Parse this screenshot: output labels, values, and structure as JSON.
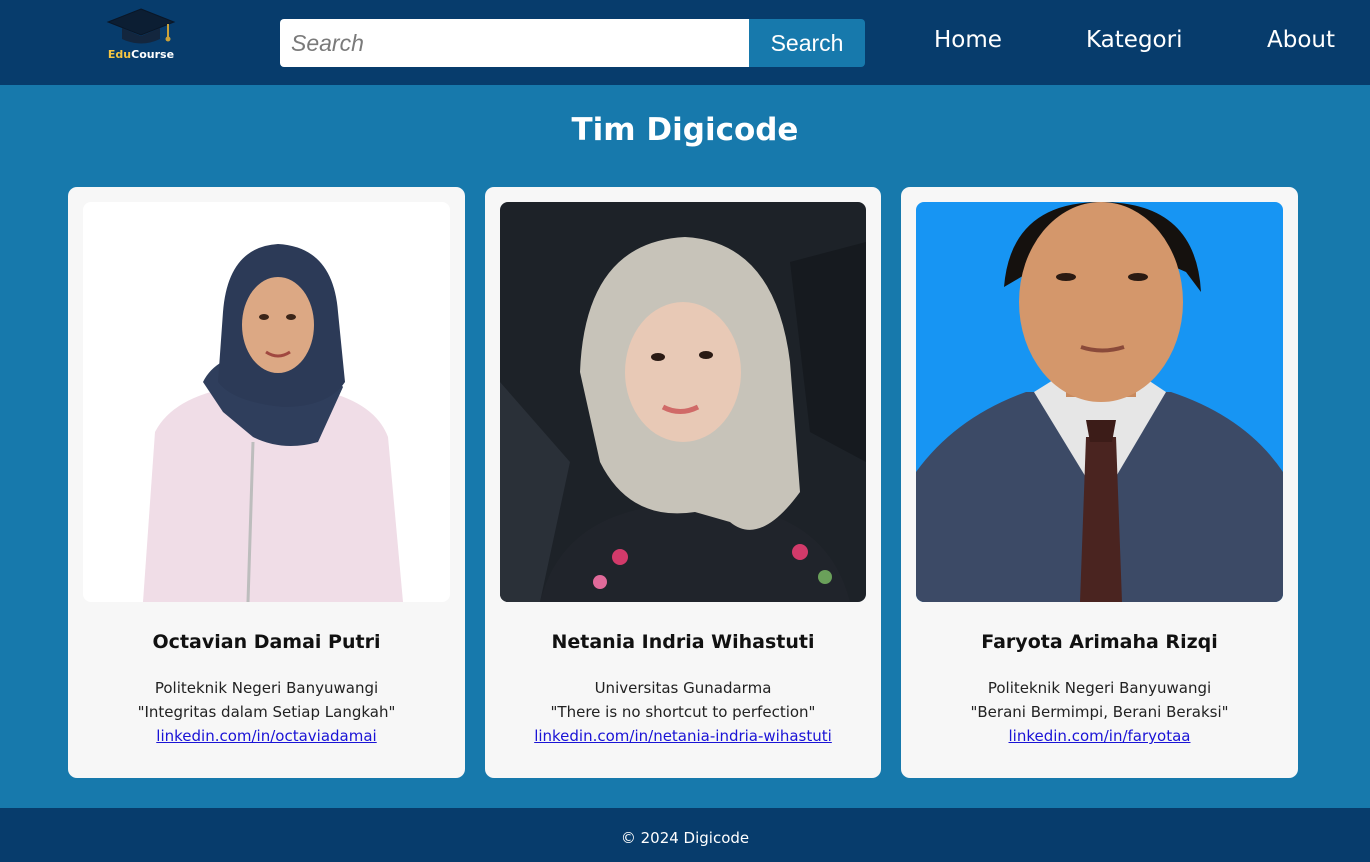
{
  "header": {
    "logo_text_part1": "Edu",
    "logo_text_part2": "Course",
    "search_placeholder": "Search",
    "search_value": "",
    "search_button_label": "Search",
    "nav": {
      "home": "Home",
      "kategori": "Kategori",
      "about": "About"
    }
  },
  "main": {
    "title": "Tim Digicode",
    "members": [
      {
        "name": "Octavian Damai Putri",
        "institution": "Politeknik Negeri Banyuwangi",
        "quote": "\"Integritas dalam Setiap Langkah\"",
        "linkedin": "linkedin.com/in/octaviadamai"
      },
      {
        "name": "Netania Indria Wihastuti",
        "institution": "Universitas Gunadarma",
        "quote": "\"There is no shortcut to perfection\"",
        "linkedin": "linkedin.com/in/netania-indria-wihastuti"
      },
      {
        "name": "Faryota Arimaha Rizqi",
        "institution": "Politeknik Negeri Banyuwangi",
        "quote": "\"Berani Bermimpi, Berani Beraksi\"",
        "linkedin": "linkedin.com/in/faryotaa"
      }
    ]
  },
  "footer": {
    "text": "© 2024 Digicode"
  },
  "colors": {
    "header_bg": "#073c6c",
    "body_bg": "#1779ac",
    "card_bg": "#f7f7f7",
    "link": "#1a13d6",
    "logo_accent": "#f5c542"
  },
  "icons": {
    "logo": "graduation-cap-icon"
  }
}
